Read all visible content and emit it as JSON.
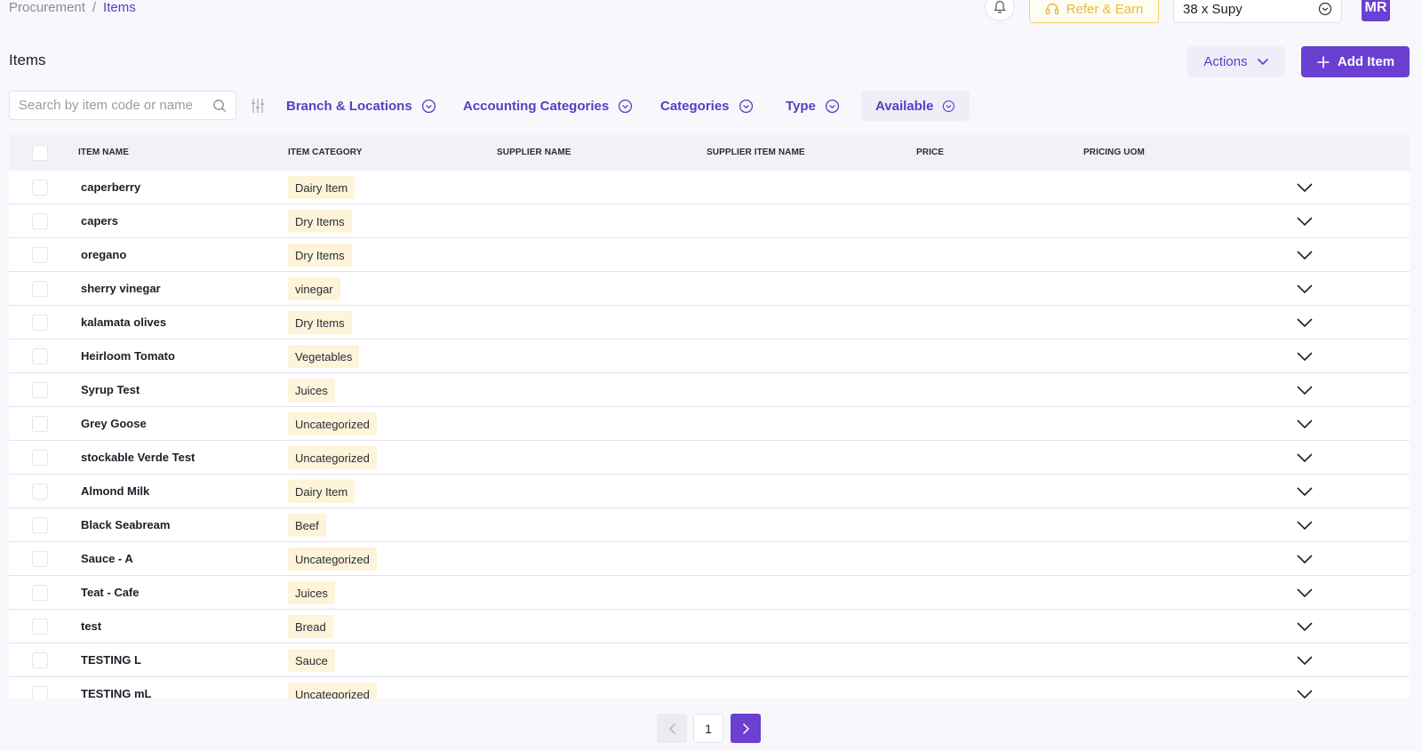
{
  "breadcrumb": {
    "parent": "Procurement",
    "separator": "/",
    "current": "Items"
  },
  "header": {
    "refer_label": "Refer & Earn",
    "org_selected": "38 x Supy",
    "avatar_initials": "MR"
  },
  "page": {
    "title": "Items",
    "actions_label": "Actions",
    "add_item_label": "Add Item"
  },
  "filters": {
    "search_placeholder": "Search by item code or name",
    "branch_locations": "Branch & Locations",
    "accounting_categories": "Accounting Categories",
    "categories": "Categories",
    "type": "Type",
    "available": "Available"
  },
  "table": {
    "columns": [
      "ITEM NAME",
      "ITEM CATEGORY",
      "SUPPLIER NAME",
      "SUPPLIER ITEM NAME",
      "PRICE",
      "PRICING UOM"
    ],
    "rows": [
      {
        "name": "caperberry",
        "category": "Dairy Item"
      },
      {
        "name": "capers",
        "category": "Dry Items"
      },
      {
        "name": "oregano",
        "category": "Dry Items"
      },
      {
        "name": "sherry vinegar",
        "category": "vinegar"
      },
      {
        "name": "kalamata olives",
        "category": "Dry Items"
      },
      {
        "name": "Heirloom Tomato",
        "category": "Vegetables"
      },
      {
        "name": "Syrup Test",
        "category": "Juices"
      },
      {
        "name": "Grey Goose",
        "category": "Uncategorized"
      },
      {
        "name": "stockable Verde Test",
        "category": "Uncategorized"
      },
      {
        "name": "Almond Milk",
        "category": "Dairy Item"
      },
      {
        "name": "Black Seabream",
        "category": "Beef"
      },
      {
        "name": "Sauce - A",
        "category": "Uncategorized"
      },
      {
        "name": "Teat - Cafe",
        "category": "Juices"
      },
      {
        "name": "test",
        "category": "Bread"
      },
      {
        "name": "TESTING L",
        "category": "Sauce"
      },
      {
        "name": "TESTING mL",
        "category": "Uncategorized"
      }
    ]
  },
  "pagination": {
    "current_page": "1"
  },
  "colors": {
    "accent": "#6a3fd1",
    "accent_text": "#5b3cc4",
    "tag_bg": "#fdf4d9",
    "refer_yellow": "#e9b93a"
  },
  "icons": {
    "bell": "bell-icon",
    "refer": "headset-icon",
    "dropdown": "chevron-circle-icon",
    "search": "search-icon",
    "filter_settings": "sliders-icon",
    "row_expand": "chevron-down-icon",
    "add": "plus-icon"
  }
}
